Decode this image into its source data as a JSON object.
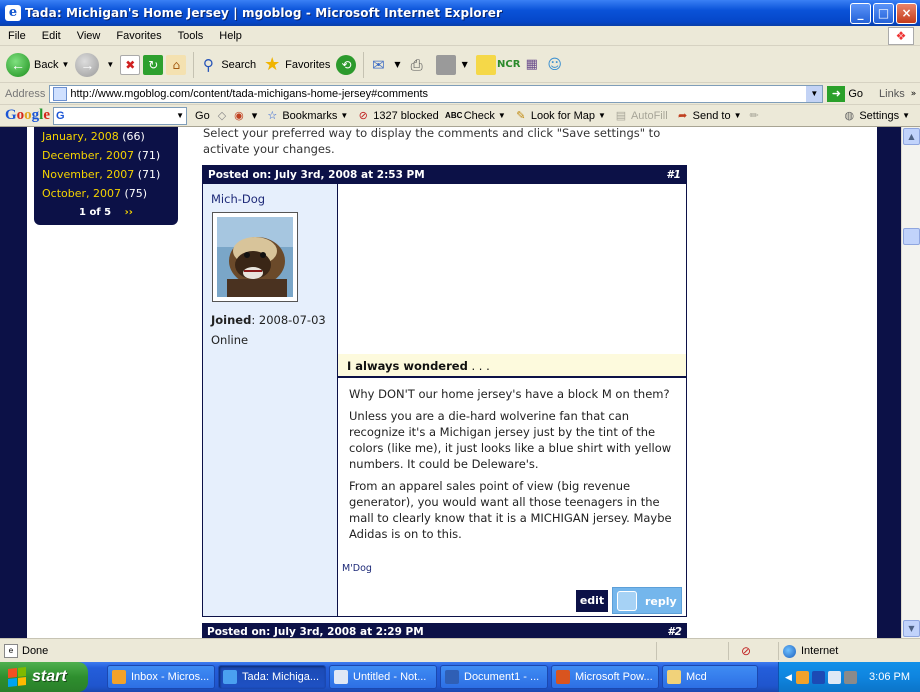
{
  "window": {
    "title": "Tada: Michigan's Home Jersey | mgoblog - Microsoft Internet Explorer",
    "controls": [
      "_",
      "□",
      "×"
    ]
  },
  "menu": [
    "File",
    "Edit",
    "View",
    "Favorites",
    "Tools",
    "Help"
  ],
  "toolbar": {
    "back_label": "Back",
    "search_label": "Search",
    "favorites_label": "Favorites"
  },
  "address": {
    "label": "Address",
    "url": "http://www.mgoblog.com/content/tada-michigans-home-jersey#comments",
    "go_label": "Go",
    "links_label": "Links"
  },
  "google_toolbar": {
    "logo": "Google",
    "search_prefix": "G",
    "go_label": "Go",
    "bookmarks_label": "Bookmarks",
    "blocked_label": "1327 blocked",
    "check_label": "Check",
    "lookup_label": "Look for Map",
    "autofill_label": "AutoFill",
    "sendto_label": "Send to",
    "settings_label": "Settings"
  },
  "sidebar": {
    "archive": [
      {
        "month": "January, 2008",
        "count": "(66)"
      },
      {
        "month": "December, 2007",
        "count": "(71)"
      },
      {
        "month": "November, 2007",
        "count": "(71)"
      },
      {
        "month": "October, 2007",
        "count": "(75)"
      }
    ],
    "pager": {
      "label": "1 of 5",
      "next": "››"
    }
  },
  "instructions": "Select your preferred way to display the comments and click \"Save settings\" to activate your changes.",
  "comment": {
    "header": "Posted on: July 3rd, 2008 at 2:53 PM",
    "number": "#1",
    "author": "Mich-Dog",
    "joined_label": "Joined",
    "joined_date": ": 2008-07-03",
    "online_status": "Online",
    "subject": "I always wondered",
    "subject_suffix": " . . .",
    "paragraphs": [
      "Why DON'T our home jersey's have a block M on them?",
      "Unless you are a die-hard wolverine fan that can recognize it's a Michigan jersey just by the tint of the colors (like me), it just looks like a blue shirt with yellow numbers. It could be Deleware's.",
      "From an apparel sales point of view (big revenue generator), you would want all those teenagers in the mall to clearly know that it is a MICHIGAN jersey. Maybe Adidas is on to this."
    ],
    "signature": "M'Dog",
    "edit_label": "edit",
    "reply_label": "reply"
  },
  "comment2": {
    "header": "Posted on: July 3rd, 2008 at 2:29 PM",
    "number": "#2"
  },
  "status": {
    "text": "Done",
    "zone": "Internet"
  },
  "taskbar": {
    "start_label": "start",
    "tasks": [
      {
        "label": "Inbox - Micros...",
        "color": "#f2a22a"
      },
      {
        "label": "Tada: Michiga...",
        "color": "#4aa0f0"
      },
      {
        "label": "Untitled - Not...",
        "color": "#dfe8f5"
      },
      {
        "label": "Document1 - ...",
        "color": "#2f5fb5"
      },
      {
        "label": "Microsoft Pow...",
        "color": "#d9541f"
      },
      {
        "label": "Mcd",
        "color": "#f1d27a"
      }
    ],
    "clock": "3:06 PM"
  },
  "colors": {
    "site_navy": "#0c1147",
    "archive_link": "#f5d300",
    "author_panel": "#e6effc",
    "subject_bg": "#fdfadd",
    "reply_button": "#74b6ec"
  }
}
